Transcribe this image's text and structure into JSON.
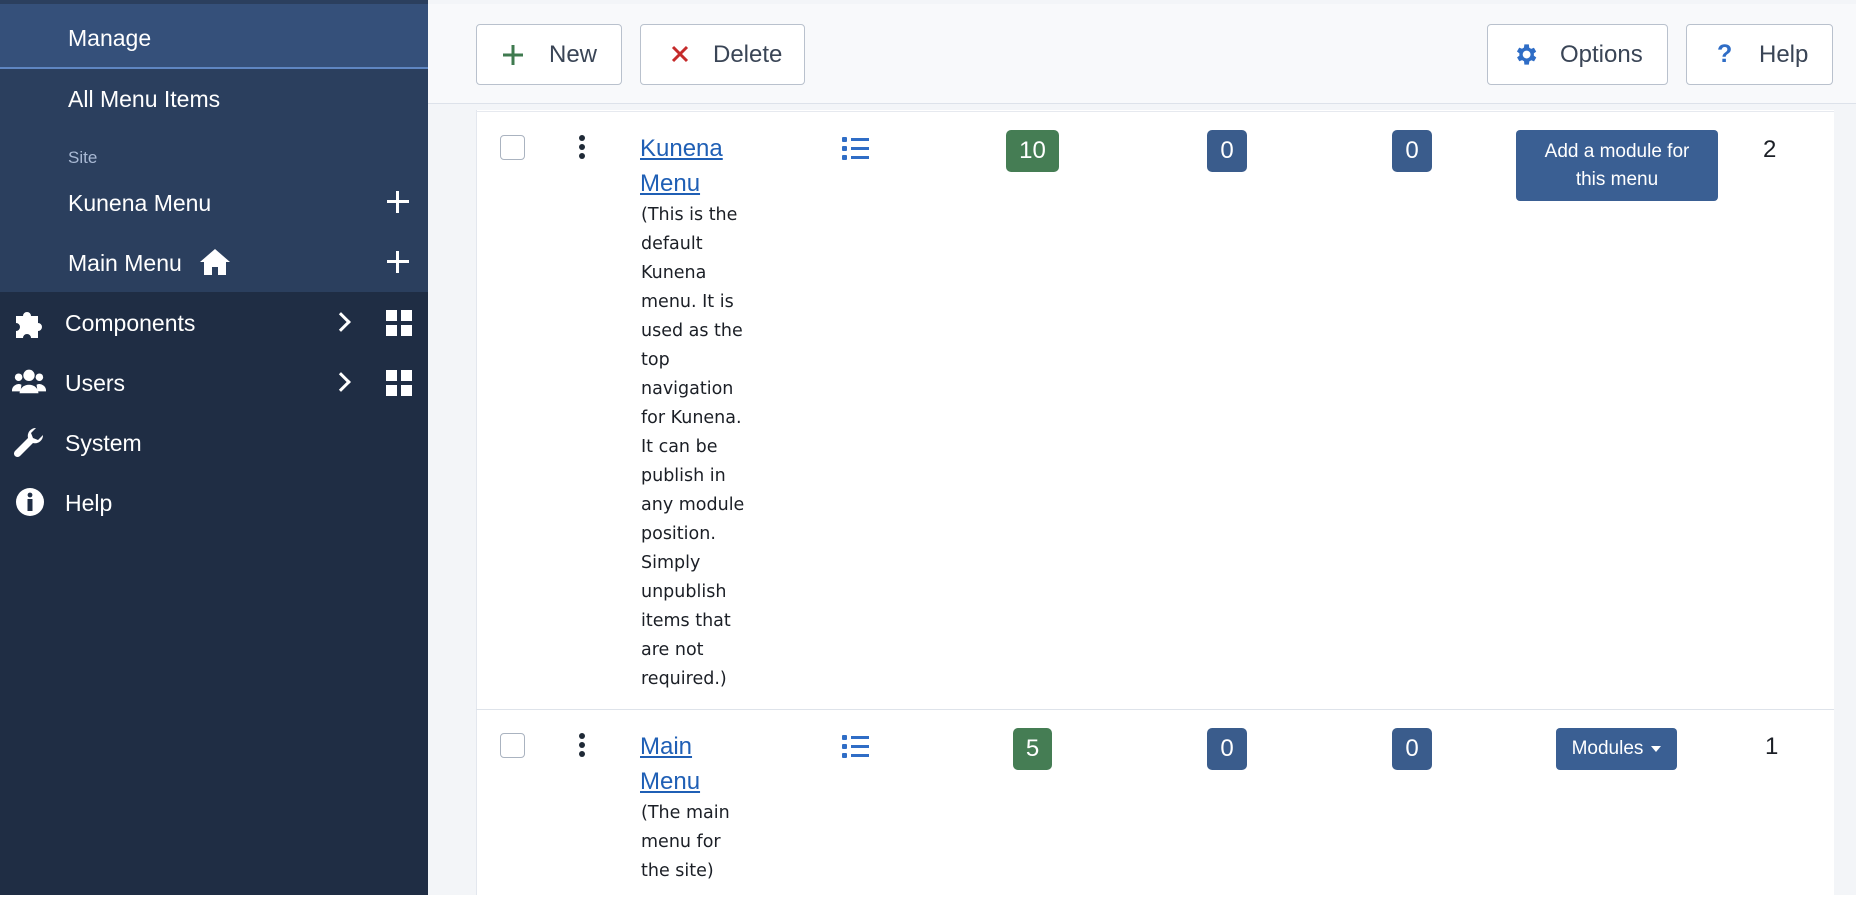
{
  "sidebar": {
    "manage_label": "Manage",
    "all_menu_items_label": "All Menu Items",
    "site_heading": "Site",
    "menus": [
      {
        "label": "Kunena Menu"
      },
      {
        "label": "Main Menu",
        "home": true
      }
    ],
    "items": [
      {
        "label": "Components",
        "icon": "puzzle-icon"
      },
      {
        "label": "Users",
        "icon": "users-icon"
      },
      {
        "label": "System",
        "icon": "wrench-icon"
      },
      {
        "label": "Help",
        "icon": "info-icon"
      }
    ]
  },
  "toolbar": {
    "new_label": "New",
    "delete_label": "Delete",
    "options_label": "Options",
    "help_label": "Help"
  },
  "rows": [
    {
      "title_line1": "Kunena",
      "title_line2": "Menu",
      "description_lines": [
        "(This is the",
        "default",
        "Kunena",
        "menu. It is",
        "used as the",
        "top",
        "navigation",
        "for Kunena.",
        "It can be",
        "publish in",
        "any module",
        "position.",
        "Simply",
        "unpublish",
        "items that",
        "are not",
        "required.)"
      ],
      "published": "10",
      "unpublished": "0",
      "trashed": "0",
      "action_line1": "Add a module for",
      "action_line2": "this menu",
      "id": "2"
    },
    {
      "title_line1": "Main",
      "title_line2": "Menu",
      "description_lines": [
        "(The main",
        "menu for",
        "the site)"
      ],
      "published": "5",
      "unpublished": "0",
      "trashed": "0",
      "action_label": "Modules",
      "id": "1"
    }
  ],
  "colors": {
    "sidebar_bg": "#1f2d44",
    "submenu_bg": "#2b3f5e",
    "published_badge": "#457d54",
    "count_badge": "#3a5c8c",
    "link": "#1f5fb5"
  }
}
